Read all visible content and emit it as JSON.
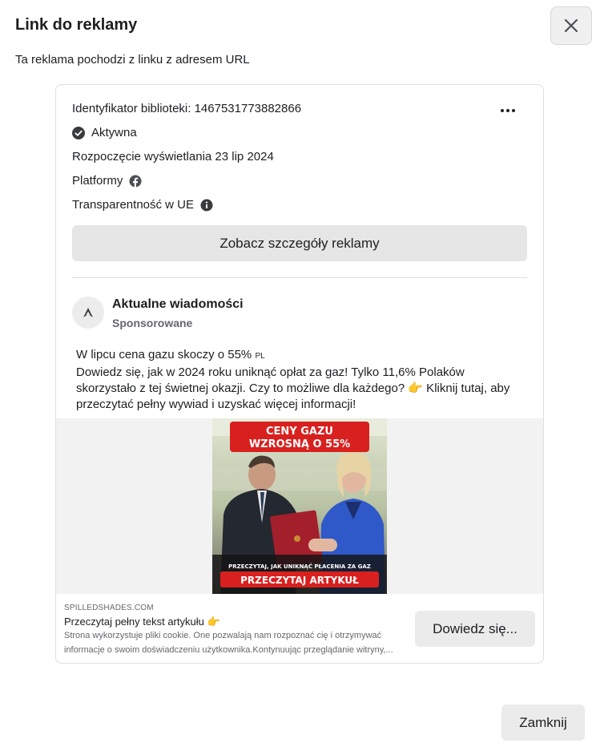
{
  "dialog": {
    "title": "Link do reklamy",
    "subtitle": "Ta reklama pochodzi z linku z adresem URL",
    "close_button": "Zamknij"
  },
  "ad_meta": {
    "library_id": "Identyfikator biblioteki: 1467531773882866",
    "status": "Aktywna",
    "start_date": "Rozpoczęcie wyświetlania 23 lip 2024",
    "platforms_label": "Platformy",
    "eu_transparency": "Transparentność w UE",
    "details_button": "Zobacz szczegóły reklamy"
  },
  "ad": {
    "page_name": "Aktualne wiadomości",
    "sponsored": "Sponsorowane",
    "text_line1": "W lipcu cena gazu skoczy o 55%",
    "text_line1_suffix": "PL",
    "text_body": "Dowiedz się, jak w 2024 roku uniknąć opłat za gaz! Tylko 11,6% Polaków skorzystało z tej świetnej okazji. Czy to możliwe dla każdego? 👉 Kliknij tutaj, aby przeczytać pełny wywiad i uzyskać więcej informacji!",
    "image": {
      "headline": "CENY GAZU WZROSNĄ O 55%",
      "caption": "PRZECZYTAJ, JAK UNIKNĄĆ PŁACENIA ZA GAZ",
      "cta": "PRZECZYTAJ ARTYKUŁ"
    },
    "link": {
      "domain": "SPILLEDSHADES.COM",
      "title": "Przeczytaj pełny tekst artykułu 👉",
      "description": "Strona wykorzystuje pliki cookie. One pozwalają nam rozpoznać cię i otrzymywać informacje o swoim doświadczeniu użytkownika.Kontynuując przeglądanie witryny,...",
      "cta_button": "Dowiedz się..."
    }
  },
  "colors": {
    "banner_red": "#d8201f",
    "sponsored_gray": "#65676b",
    "button_gray": "#e6e6e6"
  }
}
